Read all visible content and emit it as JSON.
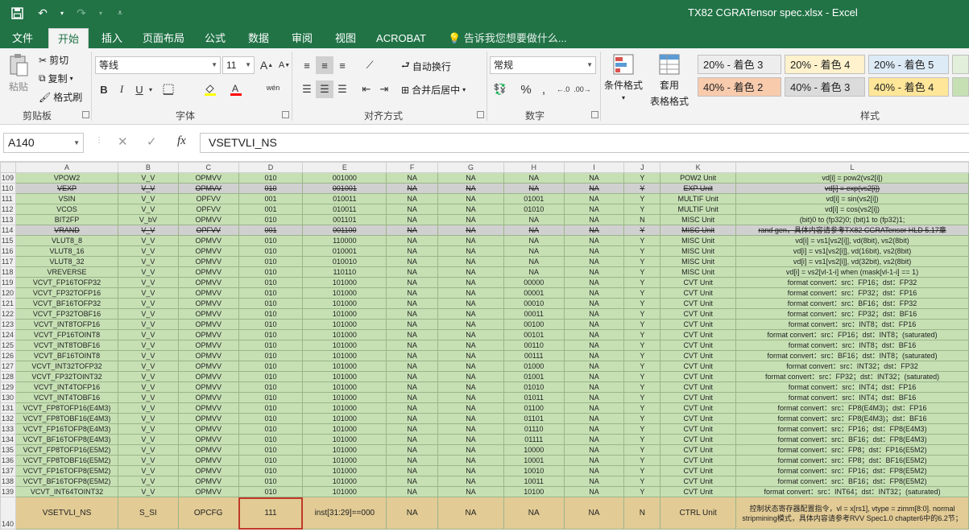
{
  "window": {
    "title": "TX82 CGRATensor spec.xlsx - Excel"
  },
  "tabs": [
    {
      "id": "file",
      "label": "文件"
    },
    {
      "id": "home",
      "label": "开始"
    },
    {
      "id": "insert",
      "label": "插入"
    },
    {
      "id": "layout",
      "label": "页面布局"
    },
    {
      "id": "formula",
      "label": "公式"
    },
    {
      "id": "data",
      "label": "数据"
    },
    {
      "id": "review",
      "label": "审阅"
    },
    {
      "id": "view",
      "label": "视图"
    },
    {
      "id": "acrobat",
      "label": "ACROBAT"
    }
  ],
  "tellme": "告诉我您想要做什么...",
  "ribbon": {
    "clipboard": {
      "label": "剪贴板",
      "paste": "粘贴",
      "cut": "剪切",
      "copy": "复制",
      "format_painter": "格式刷"
    },
    "font": {
      "label": "字体",
      "font_name": "等线",
      "font_size": "11",
      "bold": "B",
      "italic": "I",
      "underline": "U",
      "grow": "A",
      "shrink": "A",
      "wen": "wén"
    },
    "alignment": {
      "label": "对齐方式",
      "wrap": "自动换行",
      "merge": "合并后居中"
    },
    "number": {
      "label": "数字",
      "format": "常规",
      "percent": "%",
      "comma": ","
    },
    "styles": {
      "label": "样式",
      "conditional": "条件格式",
      "table1": "套用",
      "table2": "表格格式",
      "cells": [
        {
          "label": "20% - 着色 3",
          "color": "#ededed"
        },
        {
          "label": "20% - 着色 4",
          "color": "#fff2cc"
        },
        {
          "label": "20% - 着色 5",
          "color": "#ddebf7"
        },
        {
          "label": "40% - 着色 2",
          "color": "#f8cbad"
        },
        {
          "label": "40% - 着色 3",
          "color": "#dbdbdb"
        },
        {
          "label": "40% - 着色 4",
          "color": "#ffe699"
        }
      ]
    }
  },
  "formula_bar": {
    "name_box": "A140",
    "formula": "VSETVLI_NS",
    "fx": "fx"
  },
  "sheet": {
    "columns": [
      "A",
      "B",
      "C",
      "D",
      "E",
      "F",
      "G",
      "H",
      "I",
      "J",
      "K",
      "L"
    ],
    "rows": [
      {
        "n": "109",
        "cells": [
          "VPOW2",
          "V_V",
          "OPMVV",
          "010",
          "001000",
          "NA",
          "NA",
          "NA",
          "NA",
          "Y",
          "POW2 Unit",
          "vd[i] = pow2(vs2[i])"
        ]
      },
      {
        "n": "110",
        "style": "gray",
        "cells": [
          "VEXP",
          "V_V",
          "OPMVV",
          "010",
          "001001",
          "NA",
          "NA",
          "NA",
          "NA",
          "Y",
          "EXP Unit",
          "vd[i] = exp(vs2[i])"
        ]
      },
      {
        "n": "111",
        "cells": [
          "VSIN",
          "V_V",
          "OPFVV",
          "001",
          "010011",
          "NA",
          "NA",
          "01001",
          "NA",
          "Y",
          "MULTIF Unit",
          "vd[i] = sin(vs2[i])"
        ]
      },
      {
        "n": "112",
        "cells": [
          "VCOS",
          "V_V",
          "OPFVV",
          "001",
          "010011",
          "NA",
          "NA",
          "01010",
          "NA",
          "Y",
          "MULTIF Unit",
          "vd[i] = cos(vs2[i])"
        ]
      },
      {
        "n": "113",
        "cells": [
          "BIT2FP",
          "V_bV",
          "OPMVV",
          "010",
          "001101",
          "NA",
          "NA",
          "NA",
          "NA",
          "N",
          "MISC Unit",
          "(bit)0 to (fp32)0; (bit)1 to (fp32)1;"
        ]
      },
      {
        "n": "114",
        "style": "gray",
        "cells": [
          "VRAND",
          "V_V",
          "OPFVV",
          "001",
          "001100",
          "NA",
          "NA",
          "NA",
          "NA",
          "Y",
          "MISC Unit",
          "rand gen，具体内容请参考TX82 CGRATensor HLD 5.17章"
        ]
      },
      {
        "n": "115",
        "cells": [
          "VLUT8_8",
          "V_V",
          "OPMVV",
          "010",
          "110000",
          "NA",
          "NA",
          "NA",
          "NA",
          "Y",
          "MISC Unit",
          "vd[i] = vs1[vs2[i]], vd(8bit), vs2(8bit)"
        ]
      },
      {
        "n": "116",
        "cells": [
          "VLUT8_16",
          "V_V",
          "OPMVV",
          "010",
          "010001",
          "NA",
          "NA",
          "NA",
          "NA",
          "Y",
          "MISC Unit",
          "vd[i] = vs1[vs2[i]], vd(16bit), vs2(8bit)"
        ]
      },
      {
        "n": "117",
        "cells": [
          "VLUT8_32",
          "V_V",
          "OPMVV",
          "010",
          "010010",
          "NA",
          "NA",
          "NA",
          "NA",
          "Y",
          "MISC Unit",
          "vd[i] = vs1[vs2[i]], vd(32bit), vs2(8bit)"
        ]
      },
      {
        "n": "118",
        "cells": [
          "VREVERSE",
          "V_V",
          "OPMVV",
          "010",
          "110110",
          "NA",
          "NA",
          "NA",
          "NA",
          "Y",
          "MISC Unit",
          "vd[i] = vs2[vl-1-i] when (mask[vl-1-i] == 1)"
        ]
      },
      {
        "n": "119",
        "cells": [
          "VCVT_FP16TOFP32",
          "V_V",
          "OPMVV",
          "010",
          "101000",
          "NA",
          "NA",
          "00000",
          "NA",
          "Y",
          "CVT Unit",
          "format convert：src：FP16；dst：FP32"
        ]
      },
      {
        "n": "120",
        "cells": [
          "VCVT_FP32TOFP16",
          "V_V",
          "OPMVV",
          "010",
          "101000",
          "NA",
          "NA",
          "00001",
          "NA",
          "Y",
          "CVT Unit",
          "format convert：src：FP32；dst：FP16"
        ]
      },
      {
        "n": "121",
        "cells": [
          "VCVT_BF16TOFP32",
          "V_V",
          "OPMVV",
          "010",
          "101000",
          "NA",
          "NA",
          "00010",
          "NA",
          "Y",
          "CVT Unit",
          "format convert：src：BF16；dst：FP32"
        ]
      },
      {
        "n": "122",
        "cells": [
          "VCVT_FP32TOBF16",
          "V_V",
          "OPMVV",
          "010",
          "101000",
          "NA",
          "NA",
          "00011",
          "NA",
          "Y",
          "CVT Unit",
          "format convert：src：FP32；dst：BF16"
        ]
      },
      {
        "n": "123",
        "cells": [
          "VCVT_INT8TOFP16",
          "V_V",
          "OPMVV",
          "010",
          "101000",
          "NA",
          "NA",
          "00100",
          "NA",
          "Y",
          "CVT Unit",
          "format convert：src：INT8；dst：FP16"
        ]
      },
      {
        "n": "124",
        "cells": [
          "VCVT_FP16TOINT8",
          "V_V",
          "OPMVV",
          "010",
          "101000",
          "NA",
          "NA",
          "00101",
          "NA",
          "Y",
          "CVT Unit",
          "format convert：src：FP16；dst：INT8；(saturated)"
        ]
      },
      {
        "n": "125",
        "cells": [
          "VCVT_INT8TOBF16",
          "V_V",
          "OPMVV",
          "010",
          "101000",
          "NA",
          "NA",
          "00110",
          "NA",
          "Y",
          "CVT Unit",
          "format convert：src：INT8；dst：BF16"
        ]
      },
      {
        "n": "126",
        "cells": [
          "VCVT_BF16TOINT8",
          "V_V",
          "OPMVV",
          "010",
          "101000",
          "NA",
          "NA",
          "00111",
          "NA",
          "Y",
          "CVT Unit",
          "format convert：src：BF16；dst：INT8；(saturated)"
        ]
      },
      {
        "n": "127",
        "cells": [
          "VCVT_INT32TOFP32",
          "V_V",
          "OPMVV",
          "010",
          "101000",
          "NA",
          "NA",
          "01000",
          "NA",
          "Y",
          "CVT Unit",
          "format convert：src：INT32；dst：FP32"
        ]
      },
      {
        "n": "128",
        "cells": [
          "VCVT_FP32TOINT32",
          "V_V",
          "OPMVV",
          "010",
          "101000",
          "NA",
          "NA",
          "01001",
          "NA",
          "Y",
          "CVT Unit",
          "format convert：src：FP32；dst：INT32；(saturated)"
        ]
      },
      {
        "n": "129",
        "cells": [
          "VCVT_INT4TOFP16",
          "V_V",
          "OPMVV",
          "010",
          "101000",
          "NA",
          "NA",
          "01010",
          "NA",
          "Y",
          "CVT Unit",
          "format convert：src：INT4；dst：FP16"
        ]
      },
      {
        "n": "130",
        "cells": [
          "VCVT_INT4TOBF16",
          "V_V",
          "OPMVV",
          "010",
          "101000",
          "NA",
          "NA",
          "01011",
          "NA",
          "Y",
          "CVT Unit",
          "format convert：src：INT4；dst：BF16"
        ]
      },
      {
        "n": "131",
        "cells": [
          "VCVT_FP8TOFP16(E4M3)",
          "V_V",
          "OPMVV",
          "010",
          "101000",
          "NA",
          "NA",
          "01100",
          "NA",
          "Y",
          "CVT Unit",
          "format convert：src：FP8(E4M3)；dst：FP16"
        ]
      },
      {
        "n": "132",
        "cells": [
          "VCVT_FP8TOBF16(E4M3)",
          "V_V",
          "OPMVV",
          "010",
          "101000",
          "NA",
          "NA",
          "01101",
          "NA",
          "Y",
          "CVT Unit",
          "format convert：src：FP8(E4M3)；dst：BF16"
        ]
      },
      {
        "n": "133",
        "cells": [
          "VCVT_FP16TOFP8(E4M3)",
          "V_V",
          "OPMVV",
          "010",
          "101000",
          "NA",
          "NA",
          "01110",
          "NA",
          "Y",
          "CVT Unit",
          "format convert：src：FP16；dst：FP8(E4M3)"
        ]
      },
      {
        "n": "134",
        "cells": [
          "VCVT_BF16TOFP8(E4M3)",
          "V_V",
          "OPMVV",
          "010",
          "101000",
          "NA",
          "NA",
          "01111",
          "NA",
          "Y",
          "CVT Unit",
          "format convert：src：BF16；dst：FP8(E4M3)"
        ]
      },
      {
        "n": "135",
        "cells": [
          "VCVT_FP8TOFP16(E5M2)",
          "V_V",
          "OPMVV",
          "010",
          "101000",
          "NA",
          "NA",
          "10000",
          "NA",
          "Y",
          "CVT Unit",
          "format convert：src：FP8；dst：FP16(E5M2)"
        ]
      },
      {
        "n": "136",
        "cells": [
          "VCVT_FP8TOBF16(E5M2)",
          "V_V",
          "OPMVV",
          "010",
          "101000",
          "NA",
          "NA",
          "10001",
          "NA",
          "Y",
          "CVT Unit",
          "format convert：src：FP8；dst：BF16(E5M2)"
        ]
      },
      {
        "n": "137",
        "cells": [
          "VCVT_FP16TOFP8(E5M2)",
          "V_V",
          "OPMVV",
          "010",
          "101000",
          "NA",
          "NA",
          "10010",
          "NA",
          "Y",
          "CVT Unit",
          "format convert：src：FP16；dst：FP8(E5M2)"
        ]
      },
      {
        "n": "138",
        "cells": [
          "VCVT_BF16TOFP8(E5M2)",
          "V_V",
          "OPMVV",
          "010",
          "101000",
          "NA",
          "NA",
          "10011",
          "NA",
          "Y",
          "CVT Unit",
          "format convert：src：BF16；dst：FP8(E5M2)"
        ]
      },
      {
        "n": "139",
        "cells": [
          "VCVT_INT64TOINT32",
          "V_V",
          "OPMVV",
          "010",
          "101000",
          "NA",
          "NA",
          "10100",
          "NA",
          "Y",
          "CVT Unit",
          "format convert：src：INT64；dst：INT32；(saturated)"
        ]
      },
      {
        "n": "140",
        "style": "tall",
        "cells": [
          "VSETVLI_NS",
          "S_SI",
          "OPCFG",
          "111",
          "inst[31:29]==000",
          "NA",
          "NA",
          "NA",
          "NA",
          "N",
          "CTRL Unit",
          "控制状态寄存器配置指令，vl = x[rs1], vtype = zimm[8:0]. normal stripmining模式，具体内容请参考RVV Spec1.0 chapter6中的6.2节；"
        ]
      }
    ]
  }
}
